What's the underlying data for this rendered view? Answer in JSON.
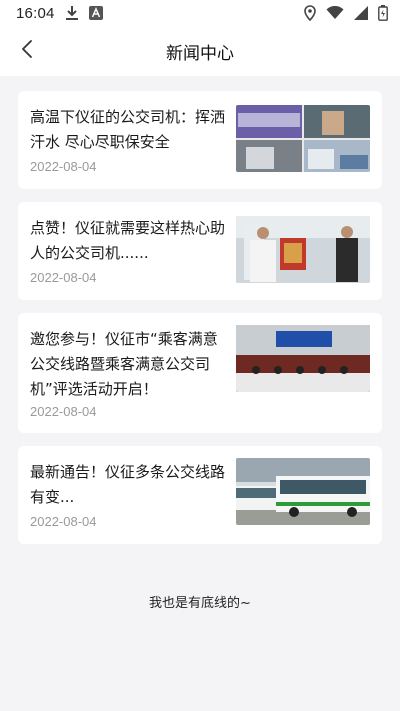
{
  "status_bar": {
    "time": "16:04",
    "icons": [
      "download-icon",
      "font-a-icon",
      "location-icon",
      "wifi-icon",
      "signal-icon",
      "battery-icon"
    ]
  },
  "header": {
    "title": "新闻中心",
    "back_icon": "chevron-left-icon"
  },
  "news": [
    {
      "title": "高温下仪征的公交司机：挥洒汗水 尽心尽职保安全",
      "date": "2022-08-04"
    },
    {
      "title": "点赞！仪征就需要这样热心助人的公交司机......",
      "date": "2022-08-04"
    },
    {
      "title": "邀您参与！仪征市“乘客满意公交线路暨乘客满意公交司机”评选活动开启！",
      "date": "2022-08-04"
    },
    {
      "title": "最新通告！仪征多条公交线路有变...",
      "date": "2022-08-04"
    }
  ],
  "footer": {
    "text": "我也是有底线的~"
  },
  "colors": {
    "background": "#f4f4f6",
    "card": "#ffffff",
    "title_text": "#1a1a1a",
    "date_text": "#9a9a9a"
  }
}
